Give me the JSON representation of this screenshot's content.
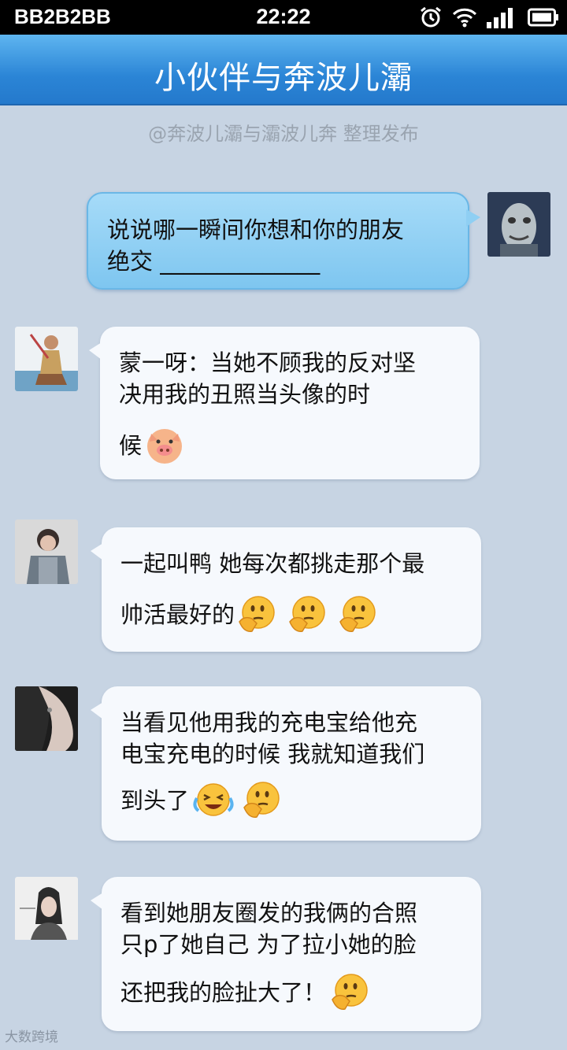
{
  "status_bar": {
    "carrier": "BB2B2BB",
    "time": "22:22",
    "icons": [
      "alarm-icon",
      "wifi-icon",
      "signal-icon",
      "battery-icon"
    ]
  },
  "header": {
    "title": "小伙伴与奔波儿灞"
  },
  "credit": "@奔波儿灞与灞波儿奔 整理发布",
  "messages": [
    {
      "side": "right",
      "lines": [
        "说说哪一瞬间你想和你的朋友",
        "绝交 ______________"
      ]
    },
    {
      "side": "left",
      "lines": [
        "蒙一呀：当她不顾我的反对坚",
        "决用我的丑照当头像的时",
        "候"
      ],
      "emoji": [
        "pig-emoji"
      ]
    },
    {
      "side": "left",
      "lines": [
        "一起叫鸭 她每次都挑走那个最",
        "帅活最好的"
      ],
      "emoji": [
        "thinking-emoji",
        "thinking-emoji",
        "thinking-emoji"
      ]
    },
    {
      "side": "left",
      "lines": [
        "当看见他用我的充电宝给他充",
        "电宝充电的时候 我就知道我们",
        "到头了"
      ],
      "emoji": [
        "laughing-crying-emoji",
        "thinking-emoji"
      ]
    },
    {
      "side": "left",
      "lines": [
        "看到她朋友圈发的我俩的合照",
        "只p了她自己 为了拉小她的脸",
        "还把我的脸扯大了！"
      ],
      "emoji": [
        "thinking-emoji"
      ]
    }
  ],
  "watermark": "大数跨境"
}
